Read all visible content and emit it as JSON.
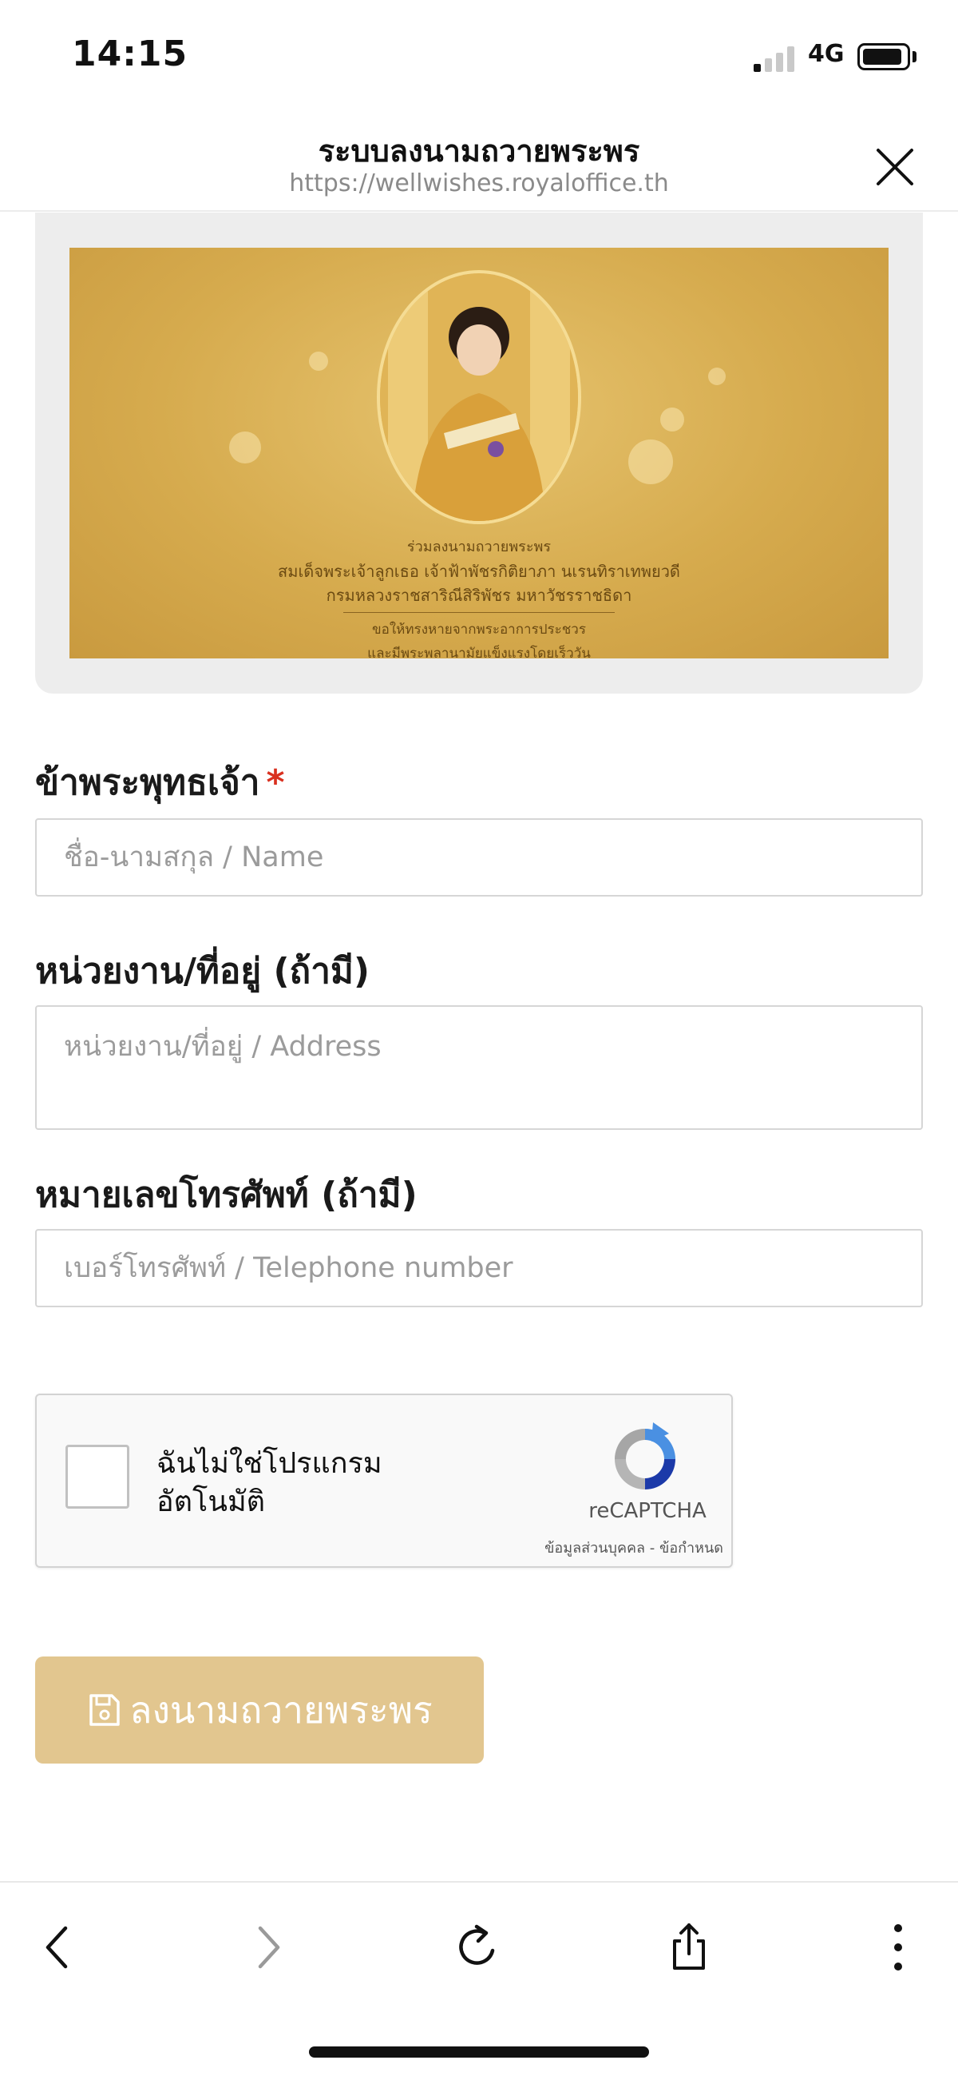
{
  "status_bar": {
    "time": "14:15",
    "network": "4G"
  },
  "browser": {
    "title": "ระบบลงนามถวายพระพร",
    "url": "https://wellwishes.royaloffice.th"
  },
  "banner": {
    "line1": "ร่วมลงนามถวายพระพร",
    "line2": "สมเด็จพระเจ้าลูกเธอ เจ้าฟ้าพัชรกิติยาภา นเรนทิราเทพยวดี",
    "line3": "กรมหลวงราชสาริณีสิริพัชร มหาวัชรราชธิดา",
    "line4": "ขอให้ทรงหายจากพระอาการประชวร",
    "line5": "และมีพระพลานามัยแข็งแรงโดยเร็ววัน"
  },
  "form": {
    "name_label": "ข้าพระพุทธเจ้า",
    "required_mark": "*",
    "name_placeholder": "ชื่อ-นามสกุล / Name",
    "address_label": "หน่วยงาน/ที่อยู่ (ถ้ามี)",
    "address_placeholder": "หน่วยงาน/ที่อยู่ / Address",
    "phone_label": "หมายเลขโทรศัพท์ (ถ้ามี)",
    "phone_placeholder": "เบอร์โทรศัพท์ / Telephone number"
  },
  "recaptcha": {
    "line1": "ฉันไม่ใช่โปรแกรม",
    "line2": "อัตโนมัติ",
    "brand": "reCAPTCHA",
    "links": "ข้อมูลส่วนบุคคล - ข้อกำหนด"
  },
  "submit": {
    "label": "ลงนามถวายพระพร"
  },
  "colors": {
    "gold": "#d6ab4e",
    "submit_bg": "#e2c68f",
    "required": "#d9301f"
  },
  "icons": [
    "signal-icon",
    "battery-icon",
    "close-icon",
    "recaptcha-logo-icon",
    "save-icon",
    "back-icon",
    "forward-icon",
    "reload-icon",
    "share-icon",
    "more-icon"
  ]
}
